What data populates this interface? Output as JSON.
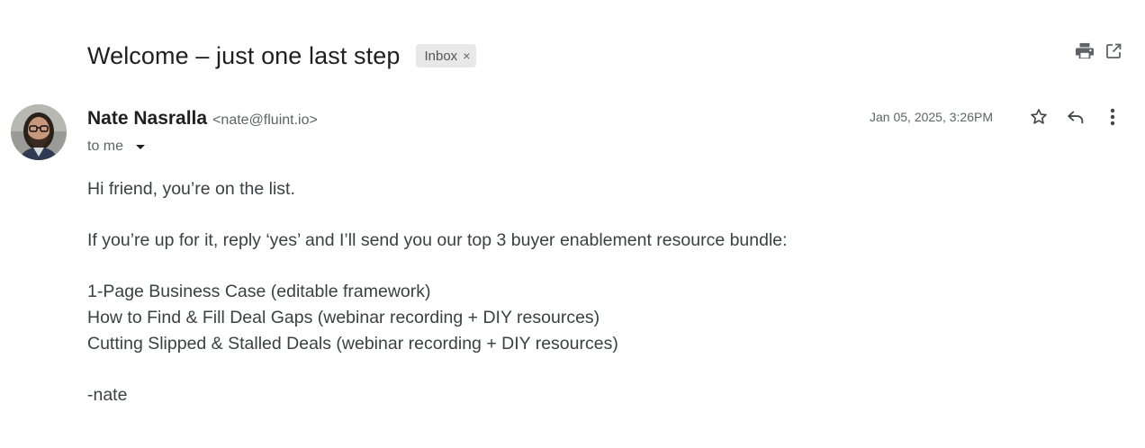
{
  "email": {
    "subject": "Welcome – just one last step",
    "label": "Inbox",
    "label_remove": "×",
    "sender_name": "Nate Nasralla",
    "sender_email": "<nate@fluint.io>",
    "recipient": "to me",
    "date": "Jan 05, 2025, 3:26PM",
    "body": {
      "greeting": "Hi friend, you’re on the list.",
      "offer": "If you’re up for it, reply ‘yes’ and I’ll send you our top 3 buyer enablement resource bundle:",
      "resources": [
        "1-Page Business Case (editable framework)",
        "How to Find & Fill Deal Gaps (webinar recording + DIY resources)",
        "Cutting Slipped & Stalled Deals (webinar recording + DIY resources)"
      ],
      "signature": "-nate"
    }
  },
  "icons": {
    "print": "print-icon",
    "open_new_window": "open-in-new-icon",
    "star": "star-icon",
    "reply": "reply-icon",
    "more": "more-vert-icon",
    "recipient_dropdown": "chevron-down-icon"
  },
  "colors": {
    "label_chip_bg": "#e8e8e8",
    "secondary_text": "#5f6368",
    "body_text": "#3c4043"
  }
}
